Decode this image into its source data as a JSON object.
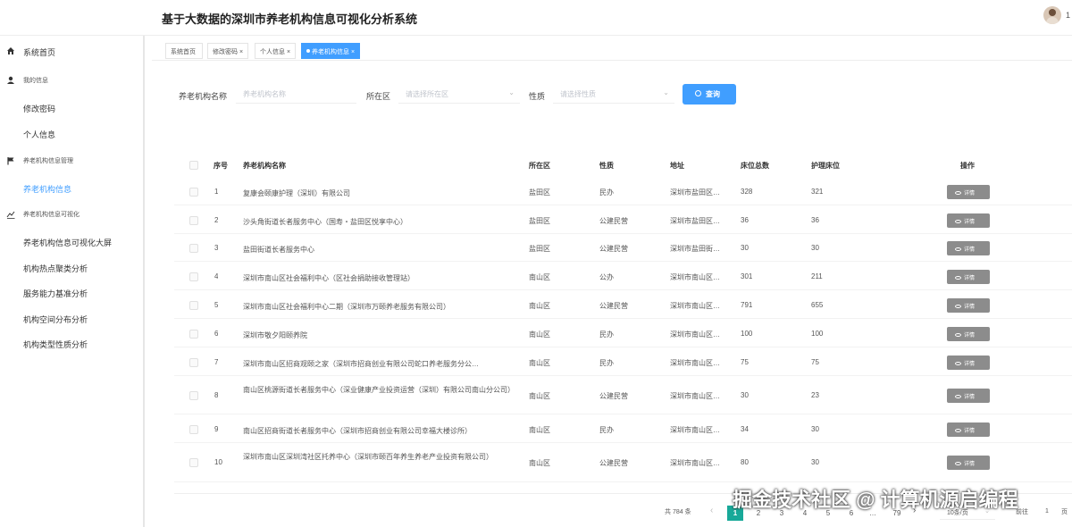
{
  "header": {
    "title": "基于大数据的深圳市养老机构信息可视化分析系统",
    "user_num": "1"
  },
  "sidebar": {
    "items": [
      {
        "label": "系统首页",
        "icon": "home-icon"
      },
      {
        "label": "我的信息",
        "icon": "user-icon"
      },
      {
        "label": "修改密码"
      },
      {
        "label": "个人信息"
      },
      {
        "label": "养老机构信息管理",
        "icon": "flag-icon"
      },
      {
        "label": "养老机构信息"
      },
      {
        "label": "养老机构信息可视化",
        "icon": "chart-icon"
      },
      {
        "label": "养老机构信息可视化大屏"
      },
      {
        "label": "机构热点聚类分析"
      },
      {
        "label": "服务能力基准分析"
      },
      {
        "label": "机构空间分布分析"
      },
      {
        "label": "机构类型性质分析"
      }
    ]
  },
  "tabs": [
    {
      "label": "系统首页",
      "close": ""
    },
    {
      "label": "修改密码",
      "close": "×"
    },
    {
      "label": "个人信息",
      "close": "×"
    },
    {
      "label": "养老机构信息",
      "close": "×"
    }
  ],
  "filters": {
    "name_label": "养老机构名称",
    "name_placeholder": "养老机构名称",
    "district_label": "所在区",
    "district_placeholder": "请选择所在区",
    "nature_label": "性质",
    "nature_placeholder": "请选择性质",
    "search_label": "查询"
  },
  "table": {
    "headers": [
      "序号",
      "养老机构名称",
      "所在区",
      "性质",
      "地址",
      "床位总数",
      "护理床位",
      "操作"
    ],
    "detail_label": "详情",
    "rows": [
      {
        "no": "1",
        "name": "复康会颐康护理（深圳）有限公司",
        "district": "盐田区",
        "nature": "民办",
        "addr": "深圳市盐田区…",
        "beds": "328",
        "care": "321"
      },
      {
        "no": "2",
        "name": "沙头角街道长者服务中心（国寿・盐田区悦享中心）",
        "district": "盐田区",
        "nature": "公建民营",
        "addr": "深圳市盐田区…",
        "beds": "36",
        "care": "36"
      },
      {
        "no": "3",
        "name": "盐田街道长者服务中心",
        "district": "盐田区",
        "nature": "公建民营",
        "addr": "深圳市盐田街…",
        "beds": "30",
        "care": "30"
      },
      {
        "no": "4",
        "name": "深圳市南山区社会福利中心（区社会捐助接收管理站）",
        "district": "南山区",
        "nature": "公办",
        "addr": "深圳市南山区…",
        "beds": "301",
        "care": "211"
      },
      {
        "no": "5",
        "name": "深圳市南山区社会福利中心二期（深圳市万颐养老服务有限公司）",
        "district": "南山区",
        "nature": "公建民营",
        "addr": "深圳市南山区…",
        "beds": "791",
        "care": "655"
      },
      {
        "no": "6",
        "name": "深圳市敬夕阳颐养院",
        "district": "南山区",
        "nature": "民办",
        "addr": "深圳市南山区…",
        "beds": "100",
        "care": "100"
      },
      {
        "no": "7",
        "name": "深圳市南山区招商观颐之家（深圳市招商创业有限公司蛇口养老服务分公…",
        "district": "南山区",
        "nature": "民办",
        "addr": "深圳市南山区…",
        "beds": "75",
        "care": "75"
      },
      {
        "no": "8",
        "name": "南山区桃源街道长者服务中心（深业健康产业投资运营（深圳）有限公司南山分公司）",
        "district": "南山区",
        "nature": "公建民营",
        "addr": "深圳市南山区…",
        "beds": "30",
        "care": "23"
      },
      {
        "no": "9",
        "name": "南山区招商街道长者服务中心（深圳市招商创业有限公司幸福大楼诊所）",
        "district": "南山区",
        "nature": "民办",
        "addr": "深圳市南山区…",
        "beds": "34",
        "care": "30"
      },
      {
        "no": "10",
        "name": "深圳市南山区深圳湾社区托养中心（深圳市颐百年养生养老产业投资有限公司）",
        "district": "南山区",
        "nature": "公建民营",
        "addr": "深圳市南山区…",
        "beds": "80",
        "care": "30"
      }
    ]
  },
  "pagination": {
    "total": "共 784 条",
    "prev": "‹",
    "pages": [
      "1",
      "2",
      "3",
      "4",
      "5",
      "6",
      "…",
      "79"
    ],
    "next": "›",
    "size": "10条/页",
    "goto": "前往",
    "goto_value": "1",
    "page_suffix": "页"
  },
  "watermark": "掘金技术社区 @ 计算机源启编程",
  "colors": {
    "accent": "#409eff",
    "current_page": "#18a999",
    "detail_button": "#8c8c8c"
  }
}
